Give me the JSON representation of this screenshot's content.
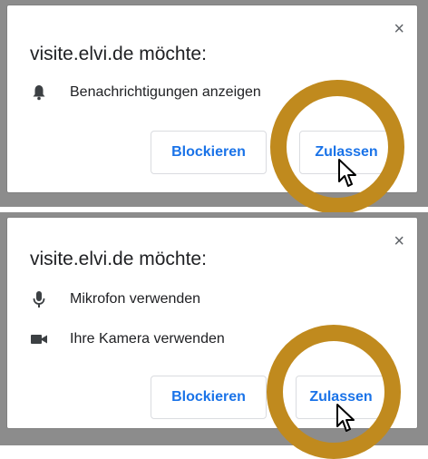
{
  "dialogs": [
    {
      "title": "visite.elvi.de möchte:",
      "close_label": "×",
      "permissions": [
        {
          "icon": "bell-icon",
          "label": "Benachrichtigungen anzeigen"
        }
      ],
      "block_label": "Blockieren",
      "allow_label": "Zulassen"
    },
    {
      "title": "visite.elvi.de möchte:",
      "close_label": "×",
      "permissions": [
        {
          "icon": "microphone-icon",
          "label": "Mikrofon verwenden"
        },
        {
          "icon": "camera-icon",
          "label": "Ihre Kamera verwenden"
        }
      ],
      "block_label": "Blockieren",
      "allow_label": "Zulassen"
    }
  ],
  "colors": {
    "accent": "#1a73e8",
    "highlight": "#c08a1e",
    "backdrop": "#8c8c8c"
  }
}
